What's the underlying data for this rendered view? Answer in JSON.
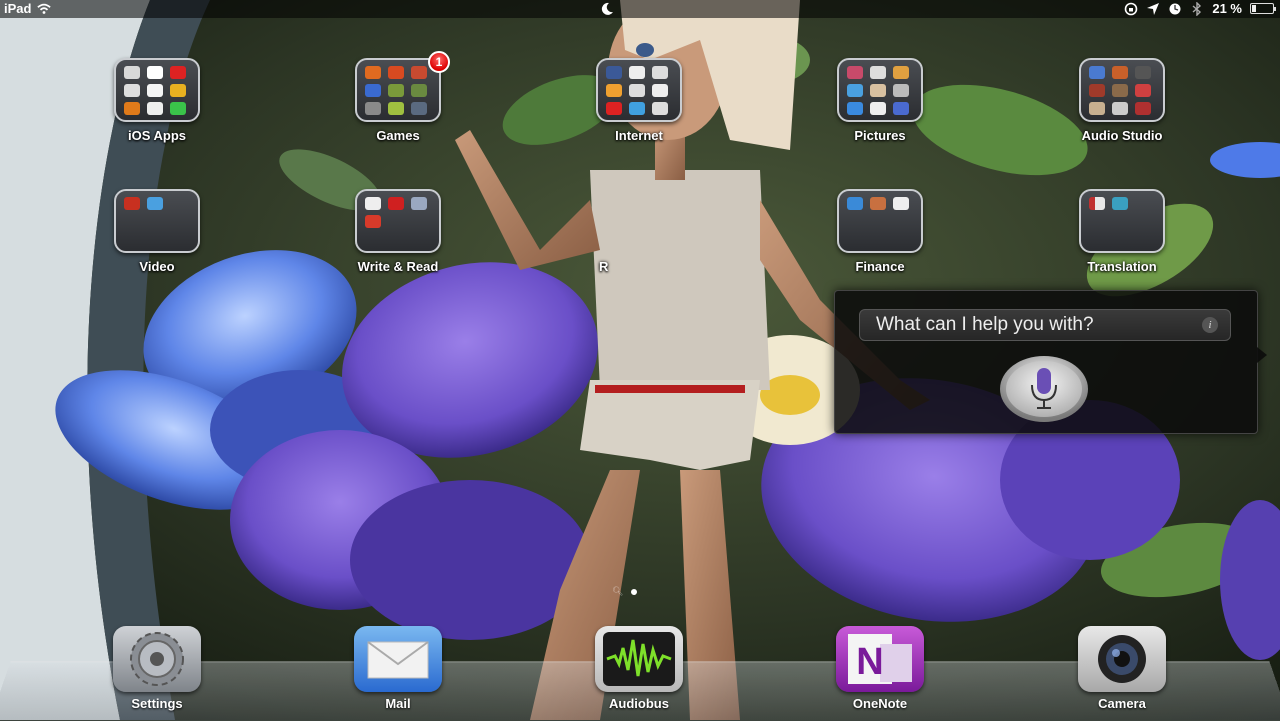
{
  "status_bar": {
    "device": "iPad",
    "battery_text": "21 %",
    "icons": [
      "wifi-icon",
      "moon-icon",
      "rotation-lock-icon",
      "location-icon",
      "alarm-icon",
      "bluetooth-icon",
      "battery-icon"
    ]
  },
  "home": {
    "folders": [
      {
        "label": "iOS Apps",
        "badge": null
      },
      {
        "label": "Games",
        "badge": "1"
      },
      {
        "label": "Internet",
        "badge": null
      },
      {
        "label": "Pictures",
        "badge": null
      },
      {
        "label": "Audio Studio",
        "badge": null
      },
      {
        "label": "Video",
        "badge": null
      },
      {
        "label": "Write & Read",
        "badge": null
      },
      {
        "label": "R",
        "badge": null
      },
      {
        "label": "Finance",
        "badge": null
      },
      {
        "label": "Translation",
        "badge": null
      }
    ],
    "page_count": 2,
    "current_page": 1
  },
  "dock": {
    "apps": [
      {
        "label": "Settings",
        "icon": "settings-gear-icon"
      },
      {
        "label": "Mail",
        "icon": "mail-envelope-icon"
      },
      {
        "label": "Audiobus",
        "icon": "audiobus-waveform-icon"
      },
      {
        "label": "OneNote",
        "icon": "onenote-icon"
      },
      {
        "label": "Camera",
        "icon": "camera-lens-icon"
      }
    ]
  },
  "siri": {
    "prompt": "What can I help you with?",
    "info_glyph": "i",
    "mic_icon": "microphone-icon"
  },
  "colors": {
    "badge_red": "#d00000",
    "siri_mic_purple": "#6a4fb5",
    "flower_violet": "#6a4fc8"
  }
}
